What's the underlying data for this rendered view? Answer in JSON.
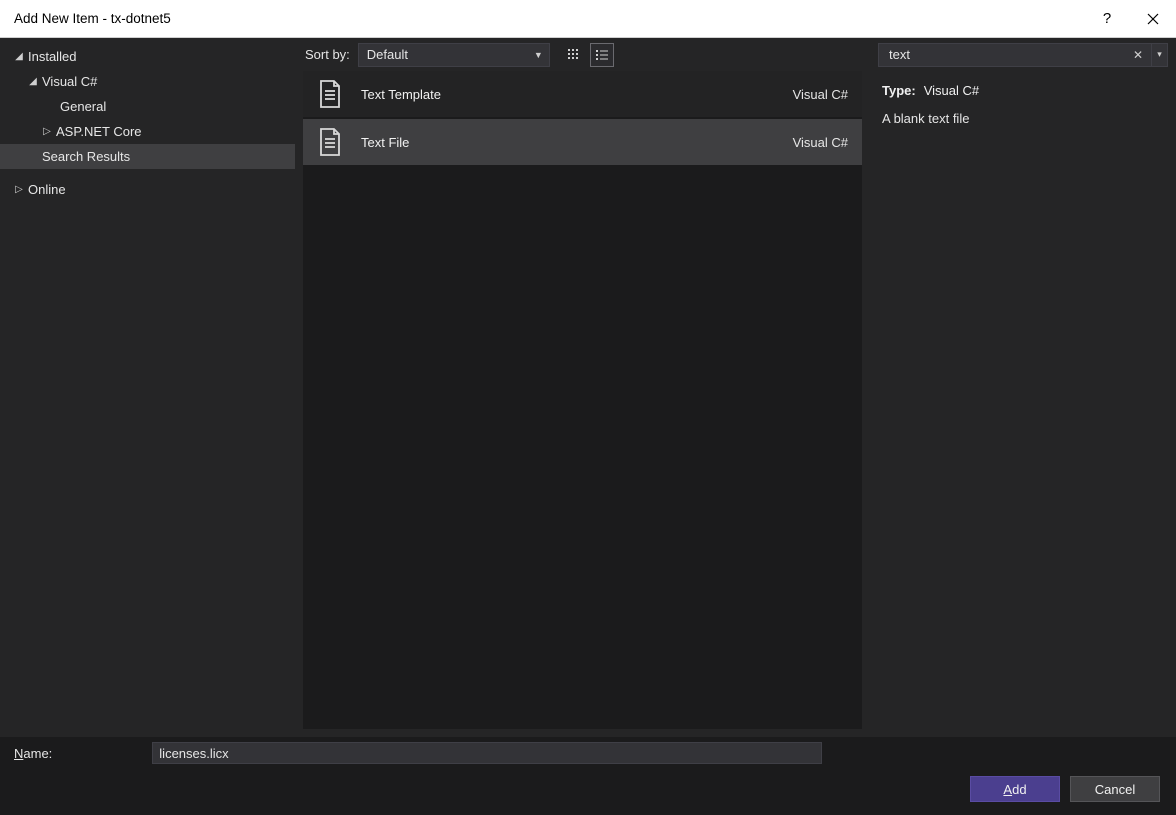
{
  "titlebar": {
    "title": "Add New Item - tx-dotnet5",
    "help": "?",
    "close": "×"
  },
  "tree": {
    "installed": "Installed",
    "csharp": "Visual C#",
    "general": "General",
    "aspnet": "ASP.NET Core",
    "search_results": "Search Results",
    "online": "Online"
  },
  "toolbar": {
    "sort_label": "Sort by:",
    "sort_value": "Default"
  },
  "items": [
    {
      "label": "Text Template",
      "category": "Visual C#"
    },
    {
      "label": "Text File",
      "category": "Visual C#"
    }
  ],
  "search": {
    "value": "text"
  },
  "details": {
    "type_label": "Type:",
    "type_value": "Visual C#",
    "description": "A blank text file"
  },
  "namebar": {
    "label_prefix": "N",
    "label_rest": "ame:",
    "value": "licenses.licx"
  },
  "footer": {
    "add_prefix": "A",
    "add_rest": "dd",
    "cancel": "Cancel"
  }
}
